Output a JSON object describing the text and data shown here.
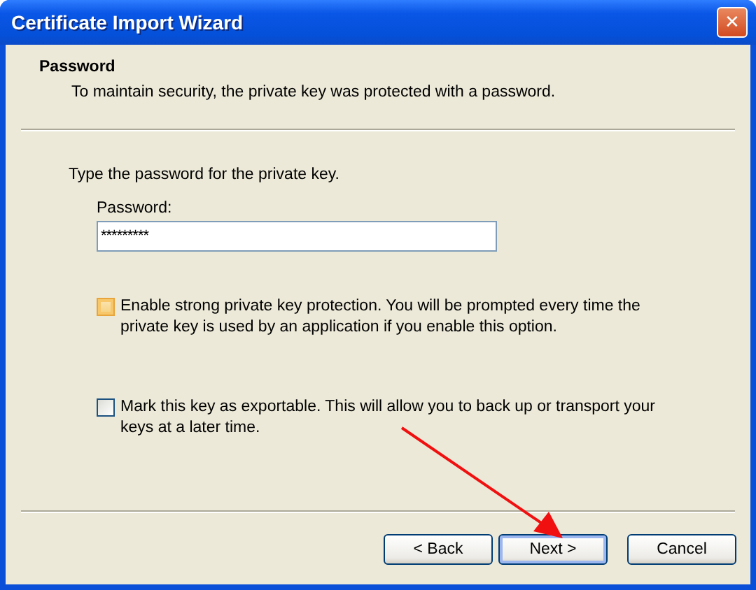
{
  "window": {
    "title": "Certificate Import Wizard",
    "close": "✕"
  },
  "header": {
    "title": "Password",
    "subtitle": "To maintain security, the private key was protected with a password."
  },
  "body": {
    "instruction": "Type the password for the private key.",
    "password_label": "Password:",
    "password_value": "*********"
  },
  "options": [
    {
      "label": "Enable strong private key protection. You will be prompted every time the private key is used by an application if you enable this option.",
      "checked": false,
      "hovered": true
    },
    {
      "label": "Mark this key as exportable. This will allow you to back up or transport your keys at a later time.",
      "checked": false,
      "hovered": false
    }
  ],
  "buttons": [
    {
      "label": "< Back",
      "default": false
    },
    {
      "label": "Next >",
      "default": true
    },
    {
      "label": "Cancel",
      "default": false
    }
  ]
}
